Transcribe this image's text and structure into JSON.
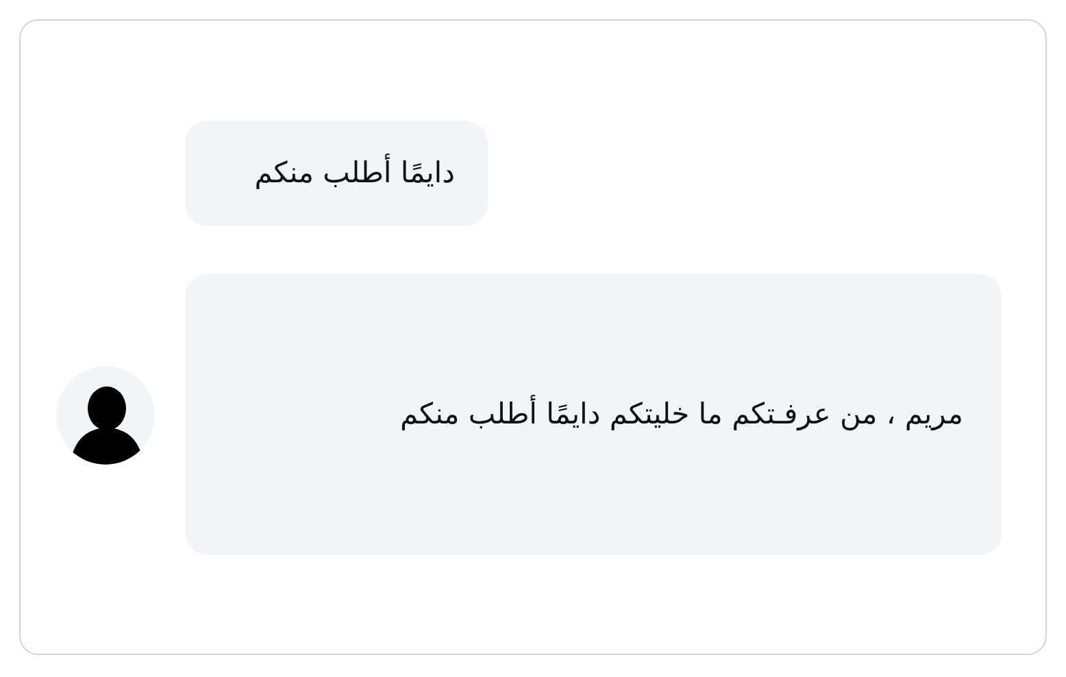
{
  "messages": [
    {
      "text": "دايمًا أطلب منكم",
      "avatar": false
    },
    {
      "text": "مريم ، من عرفـتكم ما خليتكم دايمًا أطلب منكم",
      "avatar": true
    }
  ]
}
